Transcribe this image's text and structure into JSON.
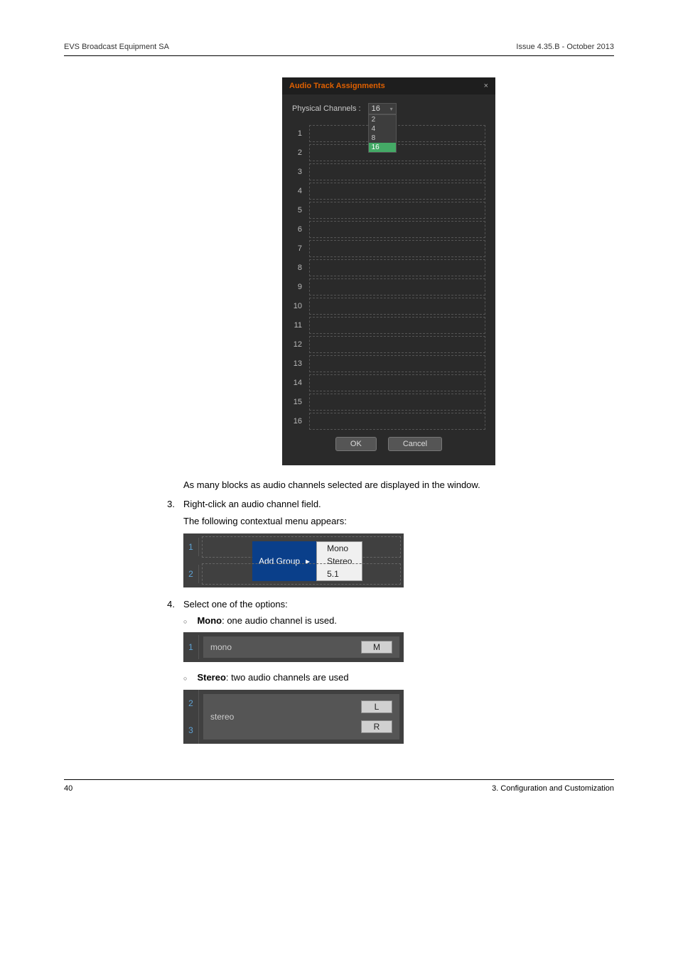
{
  "header": {
    "left": "EVS Broadcast Equipment SA",
    "right": "Issue 4.35.B - October 2013"
  },
  "dialog": {
    "title": "Audio Track Assignments",
    "close_glyph": "×",
    "physical_label": "Physical Channels :",
    "selected": "16",
    "options": [
      "2",
      "4",
      "8",
      "16"
    ],
    "rows": [
      "1",
      "2",
      "3",
      "4",
      "5",
      "6",
      "7",
      "8",
      "9",
      "10",
      "11",
      "12",
      "13",
      "14",
      "15",
      "16"
    ],
    "ok_label": "OK",
    "cancel_label": "Cancel"
  },
  "body": {
    "after_dialog": "As many blocks as audio channels selected are displayed in the window.",
    "step3_num": "3.",
    "step3_text": "Right-click an audio channel field.",
    "step3_sub": "The following contextual menu appears:",
    "step4_num": "4.",
    "step4_text": "Select one of the options:",
    "mono_label_strong": "Mono",
    "mono_label_rest": ": one audio channel is used.",
    "stereo_label_strong": "Stereo",
    "stereo_label_rest": ": two audio channels are used"
  },
  "ctx": {
    "row1_num": "1",
    "row2_num": "2",
    "add_group": "Add Group",
    "arrow": "▸",
    "submenu": [
      "Mono",
      "Stereo",
      "5.1"
    ]
  },
  "mono_box": {
    "num": "1",
    "label": "mono",
    "badge": "M"
  },
  "stereo_box": {
    "num1": "2",
    "num2": "3",
    "label": "stereo",
    "badgeL": "L",
    "badgeR": "R"
  },
  "footer": {
    "page": "40",
    "section": "3. Configuration and Customization"
  }
}
